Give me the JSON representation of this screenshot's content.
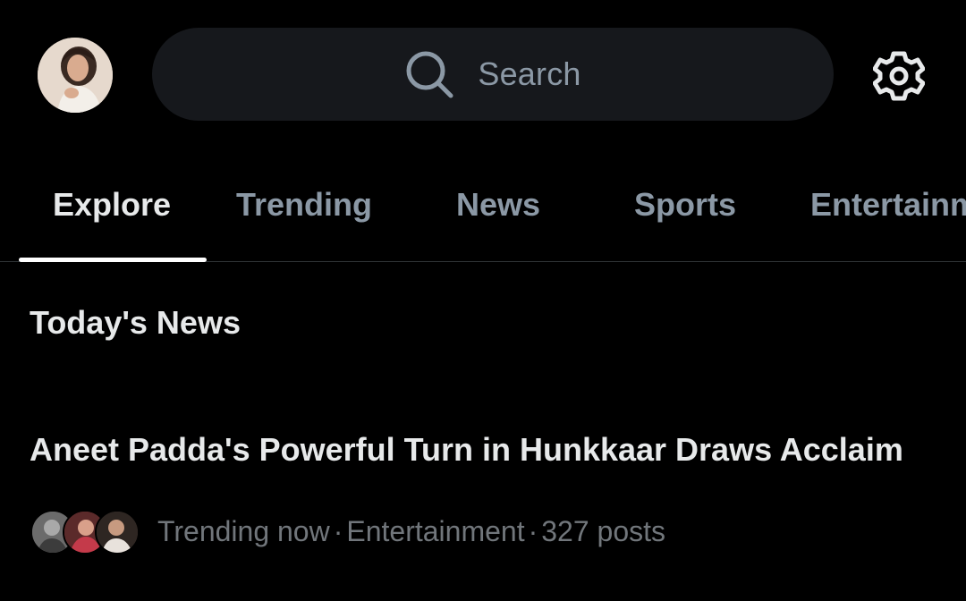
{
  "header": {
    "search_placeholder": "Search",
    "profile_avatar_icon": "profile-avatar",
    "settings_icon": "gear-icon"
  },
  "tabs": [
    {
      "label": "Explore",
      "active": true
    },
    {
      "label": "Trending",
      "active": false
    },
    {
      "label": "News",
      "active": false
    },
    {
      "label": "Sports",
      "active": false
    },
    {
      "label": "Entertainm",
      "active": false
    }
  ],
  "section": {
    "title": "Today's News"
  },
  "news_item": {
    "headline": "Aneet Padda's Powerful Turn in Hunkkaar Draws Acclaim",
    "status": "Trending now",
    "category": "Entertainment",
    "posts": "327 posts",
    "separator": "·"
  },
  "colors": {
    "background": "#000000",
    "primary_text": "#e7e9ea",
    "secondary_text": "#71767b",
    "search_bg": "#16181c",
    "divider": "#2f3336"
  }
}
